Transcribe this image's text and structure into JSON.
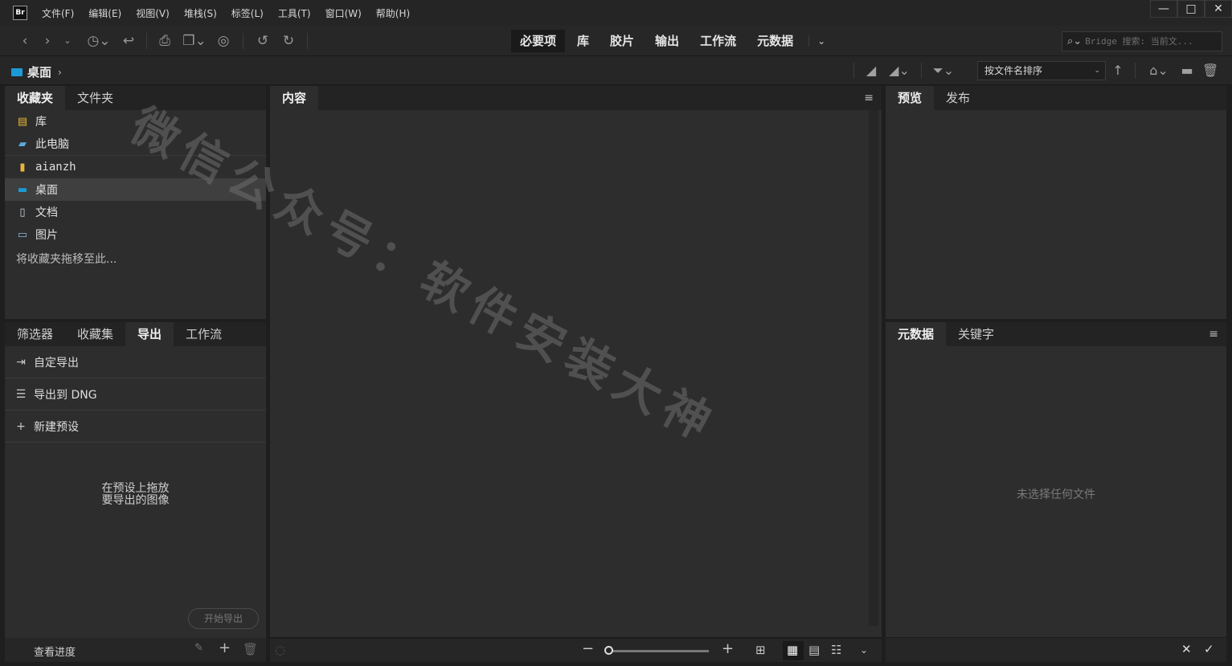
{
  "app": {
    "logo_text": "Br"
  },
  "menu": [
    "文件(F)",
    "编辑(E)",
    "视图(V)",
    "堆栈(S)",
    "标签(L)",
    "工具(T)",
    "窗口(W)",
    "帮助(H)"
  ],
  "window_controls": {
    "minimize": "—",
    "restore": "□",
    "close": "✕"
  },
  "workspaces": [
    {
      "label": "必要项",
      "active": true
    },
    {
      "label": "库",
      "active": false
    },
    {
      "label": "胶片",
      "active": false
    },
    {
      "label": "输出",
      "active": false
    },
    {
      "label": "工作流",
      "active": false
    },
    {
      "label": "元数据",
      "active": false
    }
  ],
  "search": {
    "placeholder": "Bridge 搜索: 当前文..."
  },
  "path": {
    "current": "桌面"
  },
  "sort": {
    "label": "按文件名排序"
  },
  "left_top": {
    "tabs": [
      {
        "label": "收藏夹",
        "active": true
      },
      {
        "label": "文件夹",
        "active": false
      }
    ],
    "items": [
      {
        "label": "库",
        "icon": "library-icon"
      },
      {
        "label": "此电脑",
        "icon": "computer-icon"
      },
      {
        "label": "aianzh",
        "icon": "user-folder-icon"
      },
      {
        "label": "桌面",
        "icon": "desktop-icon",
        "selected": true
      },
      {
        "label": "文档",
        "icon": "document-icon"
      },
      {
        "label": "图片",
        "icon": "pictures-icon"
      }
    ],
    "hint": "将收藏夹拖移至此..."
  },
  "left_bottom": {
    "tabs": [
      {
        "label": "筛选器"
      },
      {
        "label": "收藏集"
      },
      {
        "label": "导出",
        "active": true
      },
      {
        "label": "工作流"
      }
    ],
    "rows": [
      {
        "label": "自定导出"
      },
      {
        "label": "导出到 DNG"
      },
      {
        "label": "新建预设"
      }
    ],
    "drop_hint_line1": "在预设上拖放",
    "drop_hint_line2": "要导出的图像",
    "start_button": "开始导出",
    "progress_label": "查看进度"
  },
  "content": {
    "tab": "内容"
  },
  "right_top": {
    "tabs": [
      {
        "label": "预览",
        "active": true
      },
      {
        "label": "发布"
      }
    ]
  },
  "right_bottom": {
    "tabs": [
      {
        "label": "元数据",
        "active": true
      },
      {
        "label": "关键字"
      }
    ],
    "empty": "未选择任何文件"
  },
  "watermark": "微信公众号：软件安装大神"
}
